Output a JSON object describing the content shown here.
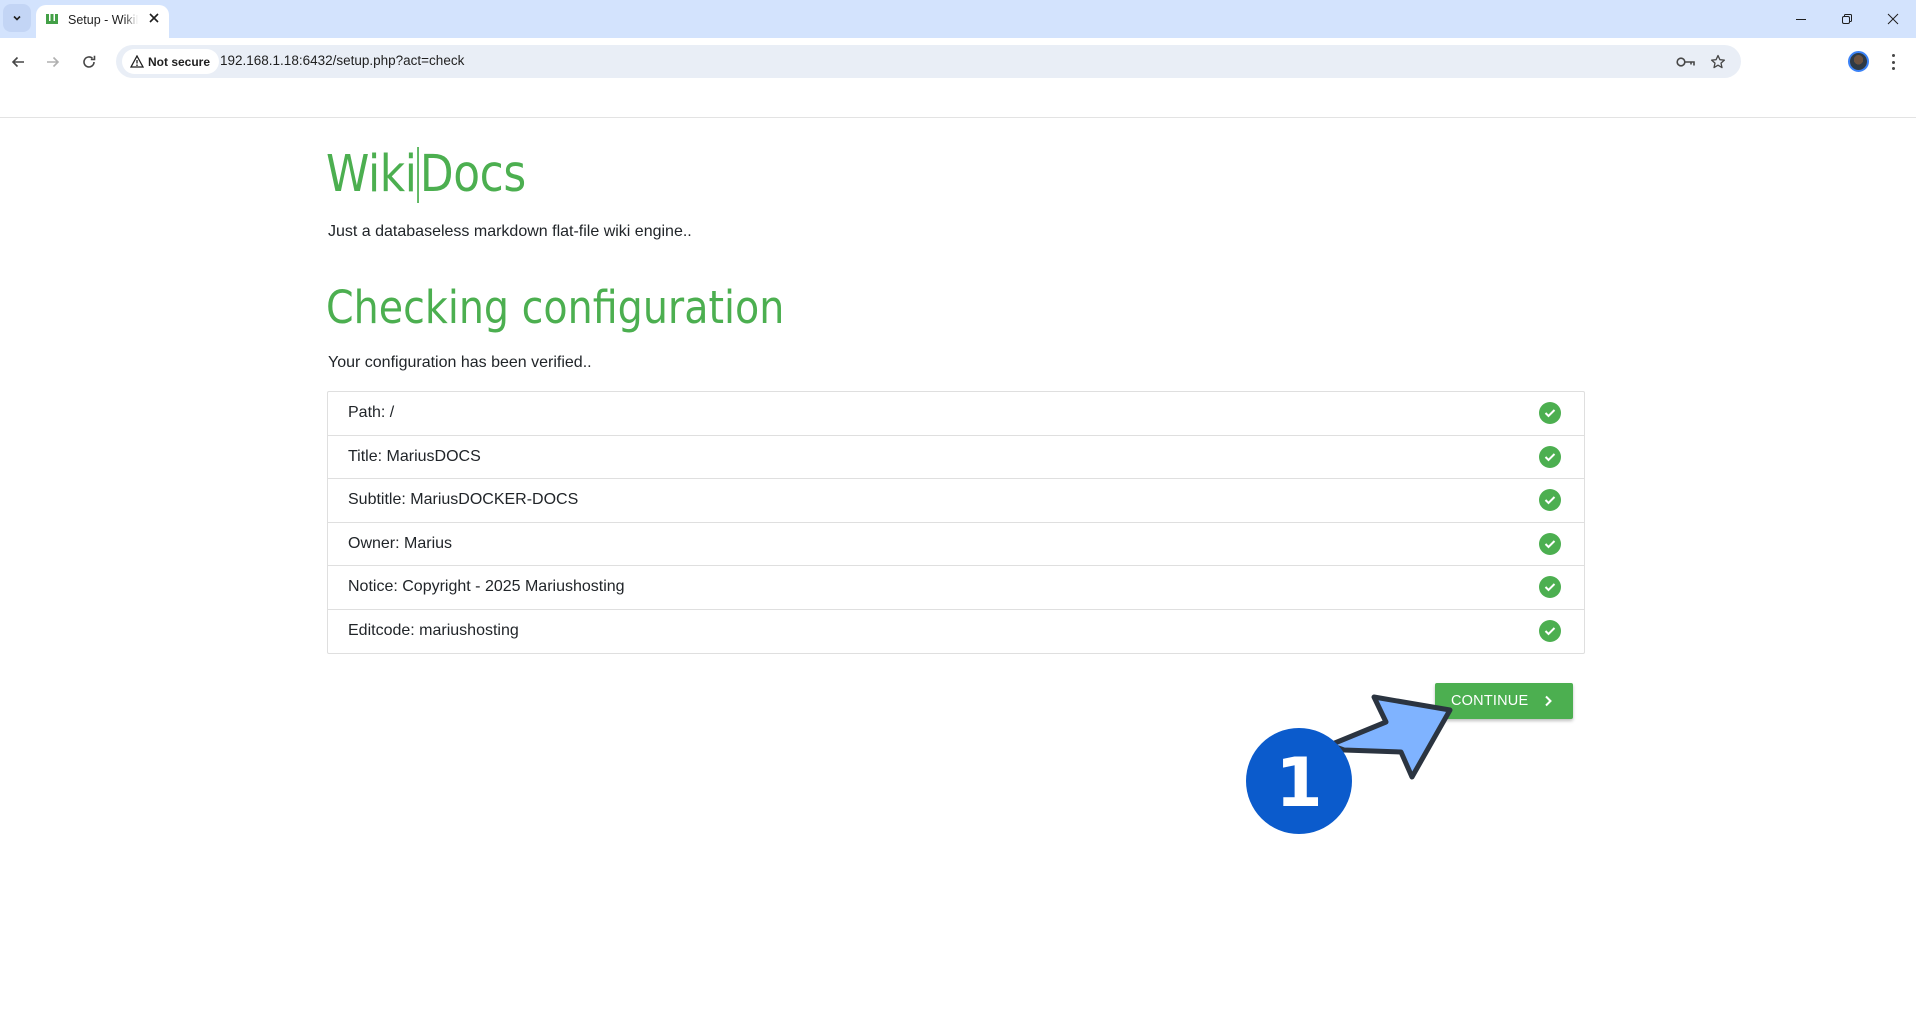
{
  "browser": {
    "tab": {
      "title": "Setup - WikiDocs",
      "favicon": "wikidocs-w-icon"
    },
    "window_controls": [
      "minimize",
      "restore",
      "close"
    ],
    "address_bar": {
      "security_label": "Not secure",
      "url": "192.168.1.18:6432/setup.php?act=check"
    },
    "toolbar_icons": [
      "back-icon",
      "forward-icon",
      "reload-icon",
      "password-key-icon",
      "bookmark-star-icon",
      "profile-avatar",
      "menu-icon"
    ]
  },
  "header": {
    "title_left": "Wiki",
    "title_right": "Docs",
    "subtitle": "Just a databaseless markdown flat-file wiki engine.."
  },
  "main": {
    "heading": "Checking configuration",
    "status": "Your configuration has been verified..",
    "checks": [
      {
        "label": "Path: /",
        "status": "ok"
      },
      {
        "label": "Title: MariusDOCS",
        "status": "ok"
      },
      {
        "label": "Subtitle: MariusDOCKER-DOCS",
        "status": "ok"
      },
      {
        "label": "Owner: Marius",
        "status": "ok"
      },
      {
        "label": "Notice: Copyright - 2025 Mariushosting",
        "status": "ok"
      },
      {
        "label": "Editcode: mariushosting",
        "status": "ok"
      }
    ],
    "continue_label": "CONTINUE"
  },
  "annotation": {
    "step_number": "1",
    "badge_color": "#0b5bcc",
    "arrow_color": "#7fb3ff"
  },
  "colors": {
    "accent": "#4caf50",
    "tabstrip": "#d3e3fd",
    "omnibox": "#e9eef6"
  }
}
